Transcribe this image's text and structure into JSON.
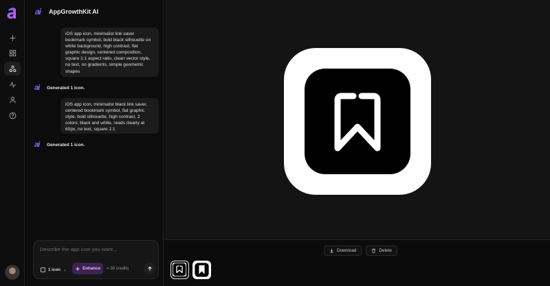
{
  "app": {
    "title": "AppGrowthKit AI",
    "brand_mark": "ai"
  },
  "rail": {
    "logo_icon": "app-a-logo",
    "items": [
      {
        "icon": "plus-icon"
      },
      {
        "icon": "grid-icon"
      },
      {
        "icon": "network-icon",
        "active": true
      },
      {
        "icon": "activity-icon"
      },
      {
        "icon": "user-icon"
      },
      {
        "icon": "help-icon"
      }
    ],
    "avatar_icon": "avatar"
  },
  "chat": {
    "messages": [
      {
        "role": "user",
        "text": "iOS app icon, minimalist link saver bookmark symbol, bold black silhouette on white background, high contrast, flat graphic design, centered composition, square 1:1 aspect ratio, clean vector style, no text, no gradients, simple geometric shapes"
      },
      {
        "role": "assistant",
        "text": "Generated 1 icon."
      },
      {
        "role": "user",
        "text": "iOS app icon, minimalist black link saver, centered bookmark symbol, flat graphic style, bold silhouette, high contrast, 2 colors: black and white, reads clearly at 60px, no text, square 1:1"
      },
      {
        "role": "assistant",
        "text": "Generated 1 icon."
      }
    ]
  },
  "composer": {
    "placeholder": "Describe the app icon you want...",
    "count_label": "1 icon",
    "enhance_label": "Enhance",
    "credits_label": "= 30 credits"
  },
  "preview": {
    "download_label": "Download",
    "delete_label": "Delete",
    "thumbnails": [
      {
        "name": "icon-variant-1",
        "selected": true
      },
      {
        "name": "icon-variant-2",
        "selected": false
      }
    ]
  },
  "colors": {
    "accent_gradient_start": "#5b6cff",
    "accent_gradient_end": "#e05bff",
    "enhance_bg": "#3a2450",
    "enhance_text": "#e9b8ff"
  }
}
